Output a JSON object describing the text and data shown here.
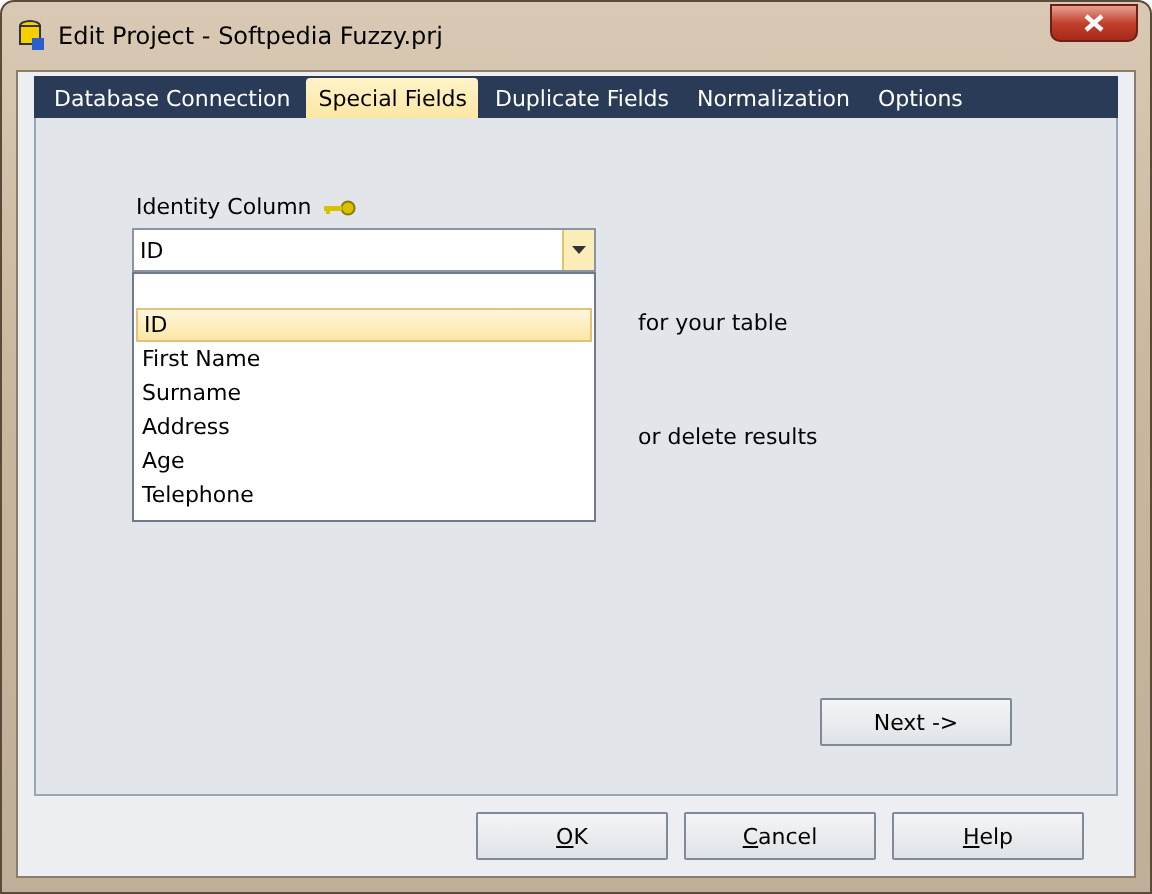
{
  "window": {
    "title": "Edit Project - Softpedia Fuzzy.prj"
  },
  "tabs": [
    {
      "label": "Database Connection",
      "selected": false
    },
    {
      "label": "Special Fields",
      "selected": true
    },
    {
      "label": "Duplicate Fields",
      "selected": false
    },
    {
      "label": "Normalization",
      "selected": false
    },
    {
      "label": "Options",
      "selected": false
    }
  ],
  "identity_column": {
    "label": "Identity Column",
    "value": "ID",
    "expanded": true,
    "options": [
      {
        "label": "ID",
        "selected": true
      },
      {
        "label": "First Name",
        "selected": false
      },
      {
        "label": "Surname",
        "selected": false
      },
      {
        "label": "Address",
        "selected": false
      },
      {
        "label": "Age",
        "selected": false
      },
      {
        "label": "Telephone",
        "selected": false
      }
    ]
  },
  "partial_texts": [
    "for your table",
    "or delete results"
  ],
  "next_button": "Next ->",
  "buttons": [
    {
      "accel": "O",
      "rest": "K"
    },
    {
      "accel": "C",
      "rest": "ancel"
    },
    {
      "accel": "H",
      "rest": "elp"
    }
  ]
}
